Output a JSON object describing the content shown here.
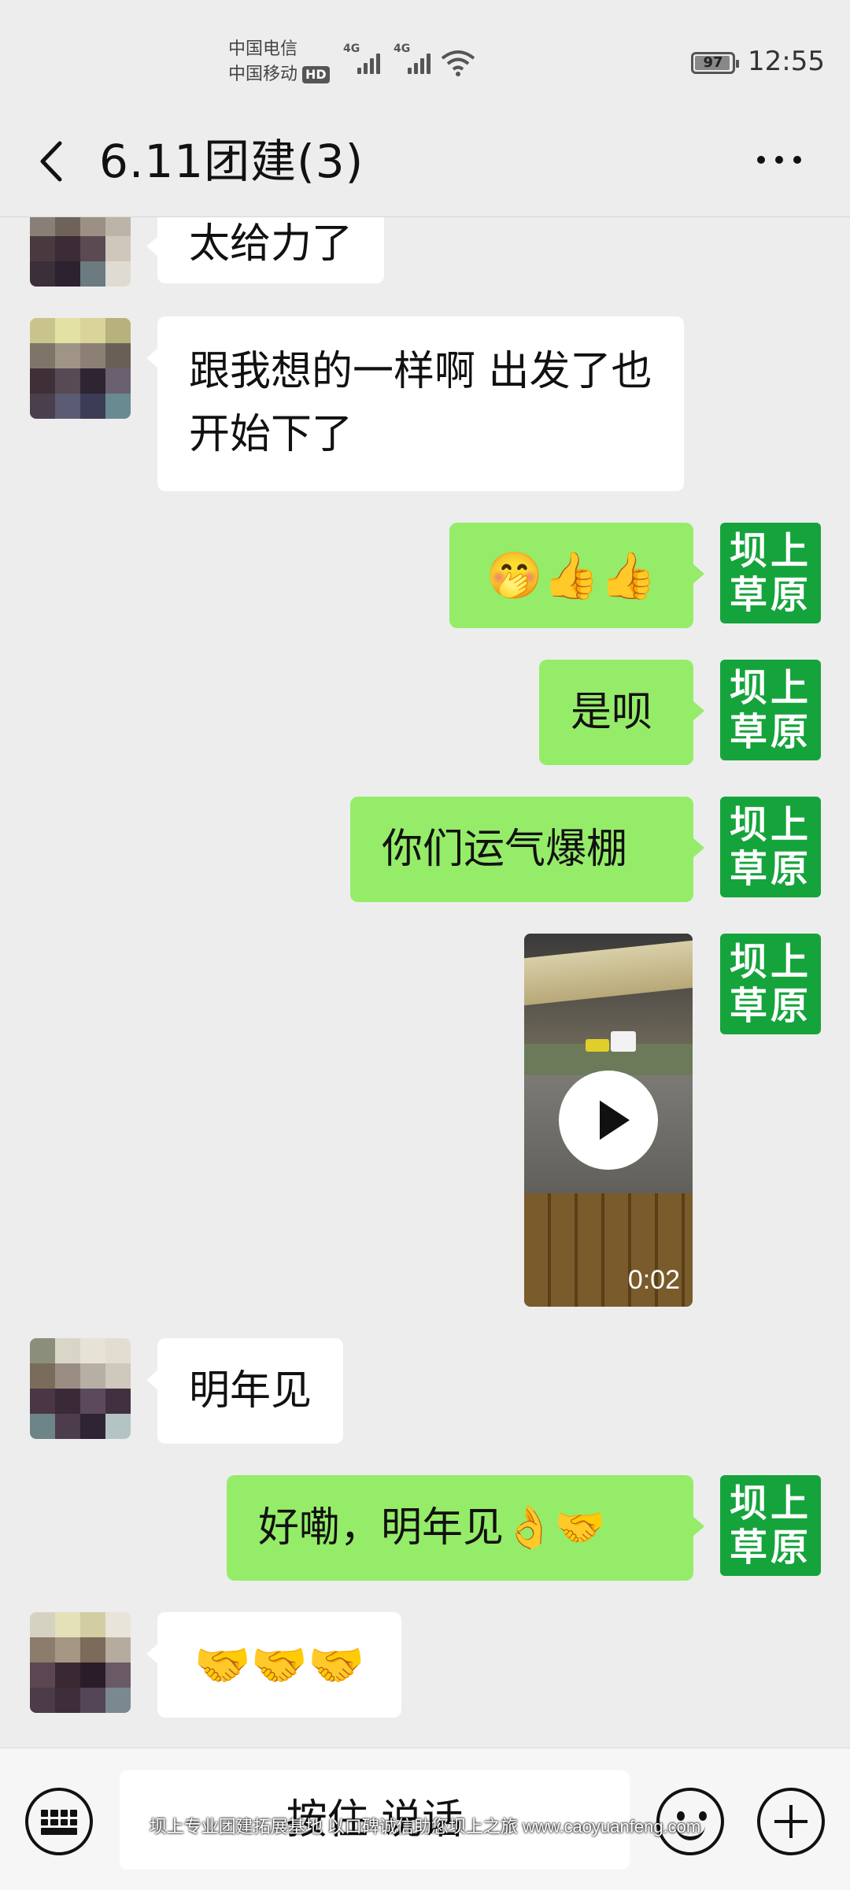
{
  "status_bar": {
    "carrier1": "中国电信",
    "carrier2": "中国移动",
    "hd_badge": "HD",
    "net1": "4G",
    "net2": "4G",
    "battery": "97",
    "time": "12:55"
  },
  "header": {
    "title": "6.11团建(3)",
    "back_icon": "chevron-left-icon",
    "more_icon": "more-horizontal-icon"
  },
  "messages": [
    {
      "dir": "in",
      "text": "太给力了"
    },
    {
      "dir": "in",
      "line1": "跟我想的一样啊 出发了也",
      "line2": "开始下了"
    },
    {
      "dir": "out",
      "text": "🤭👍👍"
    },
    {
      "dir": "out",
      "text": "是呗"
    },
    {
      "dir": "out",
      "text": "你们运气爆棚"
    },
    {
      "dir": "out",
      "type": "video",
      "duration": "0:02"
    },
    {
      "dir": "in",
      "text": "明年见"
    },
    {
      "dir": "out",
      "text": "好嘞，明年见👌🤝"
    },
    {
      "dir": "in",
      "text": "🤝🤝🤝"
    }
  ],
  "sender_avatar": {
    "line1": "坝上",
    "line2": "草原"
  },
  "bottom_bar": {
    "voice_label": "按住 说话",
    "keyboard_icon": "keyboard-icon",
    "emoji_icon": "smiley-icon",
    "plus_icon": "plus-icon"
  },
  "watermark": "坝上专业团建拓展基地 以口碑诚信助您坝上之旅 www.caoyuanfeng.com",
  "colors": {
    "outgoing_bubble": "#95ec69",
    "incoming_bubble": "#ffffff",
    "background": "#ededed",
    "logo_green": "#15a33b"
  }
}
